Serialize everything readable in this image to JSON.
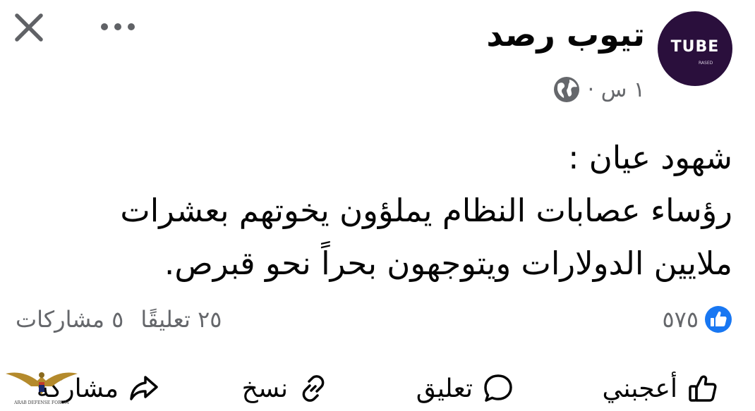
{
  "post": {
    "page_name": "تيوب رصد",
    "timestamp": "١ س ·",
    "avatar": {
      "logo_text": "TUBE",
      "logo_subtext": "RASED"
    },
    "text_lines": [
      "شهود عيان :",
      "رؤساء عصابات النظام يملؤون يخوتهم بعشرات",
      "ملايين الدولارات ويتوجهون بحراً نحو قبرص."
    ]
  },
  "stats": {
    "reactions_count": "٥٧٥",
    "comments": "٢٥ تعليقًا",
    "shares": "٥ مشاركات"
  },
  "actions": {
    "like": "أعجبني",
    "comment": "تعليق",
    "copy": "نسخ",
    "share": "مشاركة"
  },
  "watermark": {
    "text": "ARAB DEFENSE FORUM"
  },
  "icons": {
    "close": "close-icon",
    "more": "more-icon",
    "globe": "globe-icon",
    "like_badge": "like-badge-icon",
    "like": "thumbs-up-icon",
    "comment": "comment-icon",
    "copy": "link-icon",
    "share": "share-icon"
  },
  "colors": {
    "like_blue": "#1877f2",
    "meta_gray": "#65676b",
    "avatar_bg": "#2a0f3c",
    "text": "#050505"
  }
}
